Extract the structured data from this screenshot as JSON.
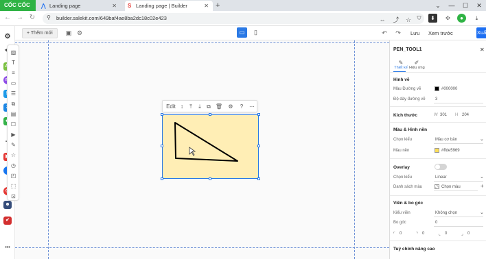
{
  "browser": {
    "brand": "CỐC CỐC",
    "tabs": [
      {
        "label": "Landing page",
        "active": false
      },
      {
        "label": "Landing page | Builder",
        "active": true
      }
    ],
    "url": "builder.salekit.com/649baf4ae8ba2dc18c02e423"
  },
  "builder": {
    "add_button": "+ Thêm mới",
    "save": "Lưu",
    "preview": "Xem trước",
    "publish": "Xuất bản"
  },
  "edit_toolbar": {
    "edit_label": "Edit"
  },
  "canvas": {
    "shape_fill": "#ffeeb5",
    "accent": "#2a79e5"
  },
  "panel": {
    "title": "PEN_TOOL1",
    "tabs": [
      "Thiết kế",
      "Hiệu ứng"
    ],
    "section_drawing": "Hình vẽ",
    "stroke_color_label": "Màu Đường vẽ",
    "stroke_color_value": "#000000",
    "stroke_width_label": "Độ dày đường vẽ",
    "stroke_width_value": "3",
    "size_label": "Kích thước",
    "w_label": "W",
    "w_value": "301",
    "h_label": "H",
    "h_value": "204",
    "section_color_bg": "Màu & Hình nền",
    "type_label": "Chọn kiểu",
    "type_value": "Màu cơ bản",
    "bg_color_label": "Màu nền",
    "bg_color_value": "#ffde5969",
    "section_overlay": "Overlay",
    "overlay_type_label": "Chọn kiểu",
    "overlay_type_value": "Linear",
    "color_list_label": "Danh sách màu",
    "color_list_value": "Chọn màu",
    "section_border": "Viền & bo góc",
    "border_type_label": "Kiểu viền",
    "border_type_value": "Không chọn",
    "radius_label": "Bo góc",
    "radius_value": "0",
    "corner_values": [
      "0",
      "0",
      "0",
      "0"
    ],
    "section_advanced": "Tuỳ chỉnh nâng cao"
  }
}
